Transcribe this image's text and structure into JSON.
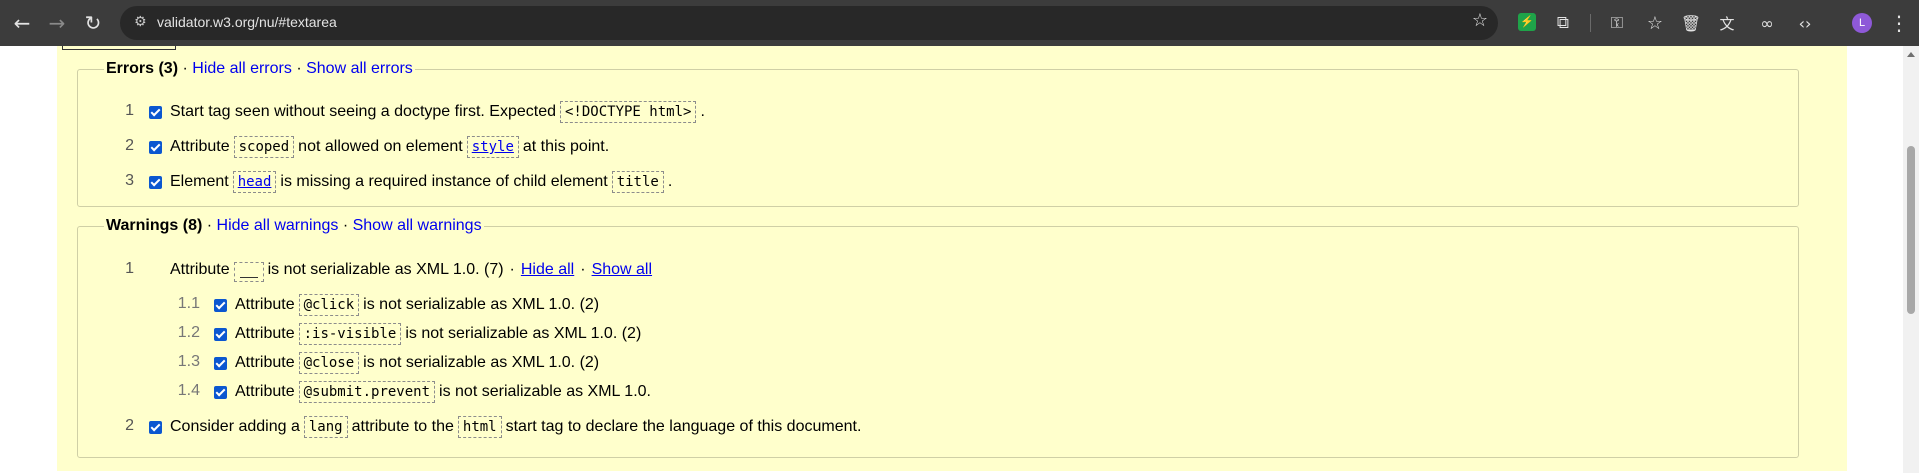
{
  "browser": {
    "url": "validator.w3.org/nu/#textarea",
    "avatar_letter": "L",
    "extension_glyph": "⚡"
  },
  "errors": {
    "legend": "Errors (3)",
    "hide_all": "Hide all errors",
    "show_all": "Show all errors",
    "sep": "·",
    "items": [
      {
        "num": "1",
        "t1": "Start tag seen without seeing a doctype first. Expected",
        "c1": "<!DOCTYPE html>",
        "t2": "."
      },
      {
        "num": "2",
        "t1": "Attribute",
        "c1": "scoped",
        "t2": "not allowed on element",
        "c2": "style",
        "t3": "at this point."
      },
      {
        "num": "3",
        "t1": "Element",
        "c1": "head",
        "t2": "is missing a required instance of child element",
        "c2": "title",
        "t3": "."
      }
    ]
  },
  "warnings": {
    "legend": "Warnings (8)",
    "hide_all": "Hide all warnings",
    "show_all": "Show all warnings",
    "group": {
      "num": "1",
      "t1": "Attribute",
      "t2": "is not serializable as XML 1.0. (7)",
      "hide_all": "Hide all",
      "show_all": "Show all"
    },
    "subitems": [
      {
        "num": "1.1",
        "t1": "Attribute",
        "c1": "@click",
        "t2": "is not serializable as XML 1.0. (2)"
      },
      {
        "num": "1.2",
        "t1": "Attribute",
        "c1": ":is-visible",
        "t2": "is not serializable as XML 1.0. (2)"
      },
      {
        "num": "1.3",
        "t1": "Attribute",
        "c1": "@close",
        "t2": "is not serializable as XML 1.0. (2)"
      },
      {
        "num": "1.4",
        "t1": "Attribute",
        "c1": "@submit.prevent",
        "t2": "is not serializable as XML 1.0."
      }
    ],
    "item2": {
      "num": "2",
      "t1": "Consider adding a",
      "c1": "lang",
      "t2": "attribute to the",
      "c2": "html",
      "t3": "start tag to declare the language of this document."
    }
  },
  "colors": {
    "panel": "#ffffcc",
    "link": "#0000ee",
    "checkbox": "#0b57d0"
  }
}
